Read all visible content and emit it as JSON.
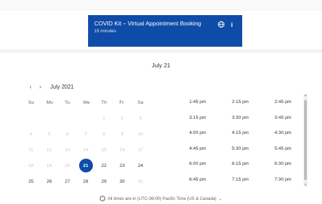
{
  "banner": {
    "title": "COVID Kit – Virtual Appointment Booking",
    "duration": "15 minutes",
    "globe_icon": "globe-icon",
    "info_icon": "info-icon",
    "color": "#0f4ca8"
  },
  "selected_date_heading": "July 21",
  "calendar": {
    "prev_label": "‹",
    "next_label": "›",
    "month_label": "July 2021",
    "weekdays": [
      "Su",
      "Mo",
      "Tu",
      "We",
      "Th",
      "Fr",
      "Sa"
    ],
    "rows": [
      [
        {
          "d": ""
        },
        {
          "d": ""
        },
        {
          "d": ""
        },
        {
          "d": ""
        },
        {
          "d": "1",
          "s": "muted"
        },
        {
          "d": "2",
          "s": "muted"
        },
        {
          "d": "3",
          "s": "muted"
        }
      ],
      [
        {
          "d": "4",
          "s": "muted"
        },
        {
          "d": "5",
          "s": "muted"
        },
        {
          "d": "6",
          "s": "muted"
        },
        {
          "d": "7",
          "s": "muted"
        },
        {
          "d": "8",
          "s": "muted"
        },
        {
          "d": "9",
          "s": "muted"
        },
        {
          "d": "10",
          "s": "muted"
        }
      ],
      [
        {
          "d": "11",
          "s": "muted"
        },
        {
          "d": "12",
          "s": "muted"
        },
        {
          "d": "13",
          "s": "muted"
        },
        {
          "d": "14",
          "s": "muted"
        },
        {
          "d": "15",
          "s": "muted"
        },
        {
          "d": "16",
          "s": "muted"
        },
        {
          "d": "17",
          "s": "muted"
        }
      ],
      [
        {
          "d": "18",
          "s": "muted"
        },
        {
          "d": "19",
          "s": "muted"
        },
        {
          "d": "20",
          "s": "muted"
        },
        {
          "d": "21",
          "s": "selected"
        },
        {
          "d": "22",
          "s": "avail"
        },
        {
          "d": "23",
          "s": "avail"
        },
        {
          "d": "24",
          "s": "avail"
        }
      ],
      [
        {
          "d": "25",
          "s": "avail"
        },
        {
          "d": "26",
          "s": "avail"
        },
        {
          "d": "27",
          "s": "avail"
        },
        {
          "d": "28",
          "s": "avail"
        },
        {
          "d": "29",
          "s": "avail"
        },
        {
          "d": "30",
          "s": "avail"
        },
        {
          "d": "31",
          "s": "muted"
        }
      ]
    ]
  },
  "time_slots": [
    "1:45 pm",
    "2:15 pm",
    "2:45 pm",
    "3:15 pm",
    "3:30 pm",
    "3:45 pm",
    "4:00 pm",
    "4:15 pm",
    "4:30 pm",
    "4:45 pm",
    "5:30 pm",
    "5:45 pm",
    "6:00 pm",
    "6:15 pm",
    "6:30 pm",
    "6:45 pm",
    "7:15 pm",
    "7:30 pm"
  ],
  "timezone": {
    "text": "All times are in  (UTC-08:00) Pacific Time (US & Canada)",
    "chevron": "⌄"
  }
}
